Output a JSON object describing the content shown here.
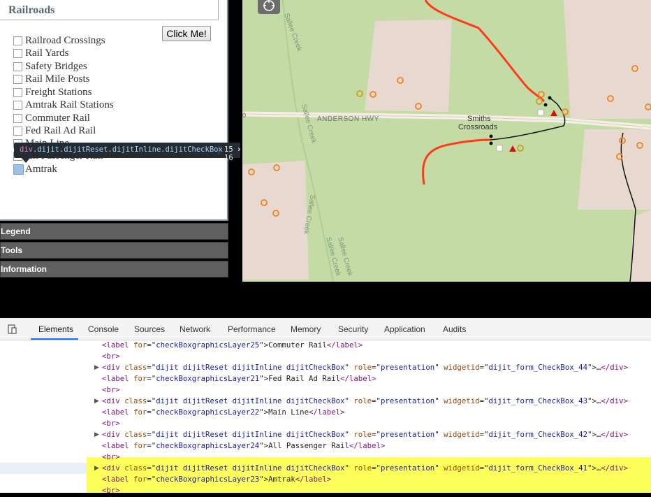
{
  "layers_panel": {
    "title": "Railroads",
    "button_label": "Click Me!",
    "checkboxes": [
      {
        "label": "Railroad Crossings"
      },
      {
        "label": "Rail Yards"
      },
      {
        "label": "Safety Bridges"
      },
      {
        "label": "Rail Mile Posts"
      },
      {
        "label": "Freight Stations"
      },
      {
        "label": "Amtrak Rail Stations"
      },
      {
        "label": "Commuter Rail"
      },
      {
        "label": "Fed Rail Ad Rail"
      },
      {
        "label": "Main Line"
      },
      {
        "label": "All Passenger Rail"
      },
      {
        "label": "Amtrak"
      }
    ]
  },
  "accordion": {
    "legend": "Legend",
    "tools": "Tools",
    "information": "Information"
  },
  "tooltip": {
    "tag": "div",
    "classes": ".dijit.dijitReset.dijitInline.dijitCheckBox",
    "size": "15 × 16"
  },
  "map": {
    "road_label": "ANDERSON HWY",
    "place_label_1": "Smiths",
    "place_label_2": "Crossroads",
    "creek_label": "Sallee Creek",
    "edge_label": "0",
    "colors": {
      "land": "#c5dba6",
      "urban": "#e7d9cf",
      "rail": "#ff3a1a",
      "road": "#f5efe6"
    }
  },
  "devtools": {
    "tabs": [
      "Elements",
      "Console",
      "Sources",
      "Network",
      "Performance",
      "Memory",
      "Security",
      "Application",
      "Audits"
    ],
    "active_tab": "Elements",
    "lines": [
      {
        "kind": "label",
        "for": "checkBoxgraphicsLayer25",
        "text": "Commuter Rail"
      },
      {
        "kind": "br"
      },
      {
        "kind": "div",
        "widgetid": "dijit_form_CheckBox_44"
      },
      {
        "kind": "label",
        "for": "checkBoxgraphicsLayer21",
        "text": "Fed Rail Ad Rail"
      },
      {
        "kind": "br"
      },
      {
        "kind": "div",
        "widgetid": "dijit_form_CheckBox_43"
      },
      {
        "kind": "label",
        "for": "checkBoxgraphicsLayer22",
        "text": "Main Line"
      },
      {
        "kind": "br"
      },
      {
        "kind": "div",
        "widgetid": "dijit_form_CheckBox_42"
      },
      {
        "kind": "label",
        "for": "checkBoxgraphicsLayer24",
        "text": "All Passenger Rail"
      },
      {
        "kind": "br"
      },
      {
        "kind": "div",
        "widgetid": "dijit_form_CheckBox_41"
      },
      {
        "kind": "label",
        "for": "checkBoxgraphicsLayer23",
        "text": "Amtrak"
      },
      {
        "kind": "br"
      }
    ],
    "div_class": "dijit dijitReset dijitInline dijitCheckBox",
    "div_role": "presentation",
    "highlight_color": "#ffff5c"
  }
}
